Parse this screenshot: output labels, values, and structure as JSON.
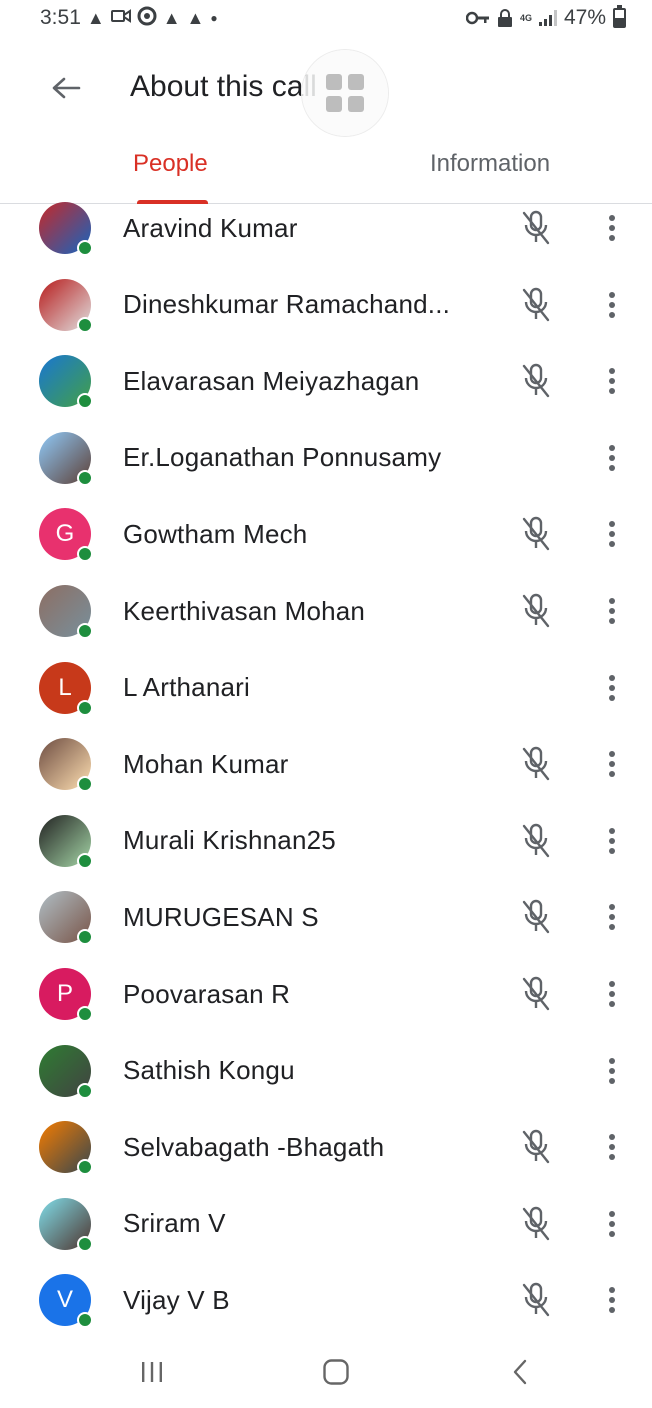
{
  "status_bar": {
    "time": "3:51",
    "left_icons": [
      "warning-icon",
      "video-icon",
      "hotspot-icon",
      "warning-icon",
      "warning-icon",
      "dot-icon"
    ],
    "network_type": "4G",
    "battery": "47%"
  },
  "header": {
    "title": "About this call"
  },
  "tabs": [
    {
      "label": "People",
      "active": true
    },
    {
      "label": "Information",
      "active": false
    }
  ],
  "colors": {
    "accent": "#d93025",
    "presence": "#1e8e3e",
    "muted_icon": "#5f6368"
  },
  "participants": [
    {
      "name": "Aravind Kumar",
      "muted": true,
      "avatar_type": "photo"
    },
    {
      "name": "Dineshkumar Ramachand...",
      "muted": true,
      "avatar_type": "photo"
    },
    {
      "name": "Elavarasan Meiyazhagan",
      "muted": true,
      "avatar_type": "photo"
    },
    {
      "name": "Er.Loganathan Ponnusamy",
      "muted": false,
      "avatar_type": "photo"
    },
    {
      "name": "Gowtham Mech",
      "muted": true,
      "avatar_type": "initial",
      "initial": "G",
      "avatar_color": "#e8316e"
    },
    {
      "name": "Keerthivasan Mohan",
      "muted": true,
      "avatar_type": "photo"
    },
    {
      "name": "L Arthanari",
      "muted": false,
      "avatar_type": "initial",
      "initial": "L",
      "avatar_color": "#c7391a"
    },
    {
      "name": "Mohan Kumar",
      "muted": true,
      "avatar_type": "photo"
    },
    {
      "name": "Murali Krishnan25",
      "muted": true,
      "avatar_type": "photo"
    },
    {
      "name": "MURUGESAN S",
      "muted": true,
      "avatar_type": "photo"
    },
    {
      "name": "Poovarasan R",
      "muted": true,
      "avatar_type": "initial",
      "initial": "P",
      "avatar_color": "#d81b60"
    },
    {
      "name": "Sathish Kongu",
      "muted": false,
      "avatar_type": "photo"
    },
    {
      "name": "Selvabagath -Bhagath",
      "muted": true,
      "avatar_type": "photo"
    },
    {
      "name": "Sriram V",
      "muted": true,
      "avatar_type": "photo"
    },
    {
      "name": "Vijay V B",
      "muted": true,
      "avatar_type": "initial",
      "initial": "V",
      "avatar_color": "#1a73e8"
    }
  ],
  "nav_bar": {
    "buttons": [
      "recents-icon",
      "home-icon",
      "back-icon"
    ]
  }
}
